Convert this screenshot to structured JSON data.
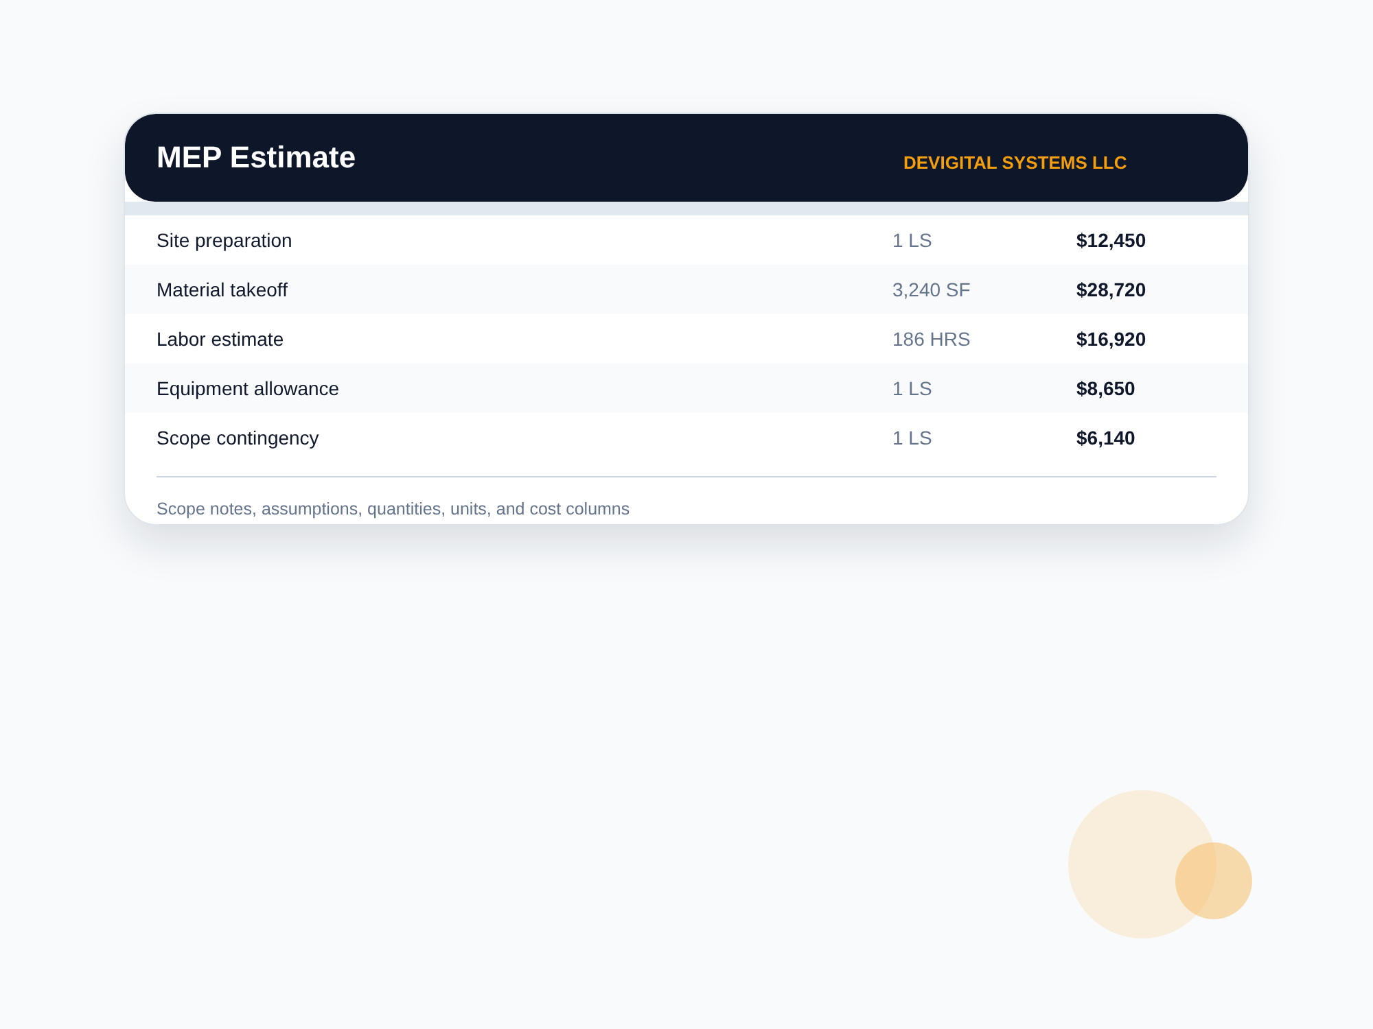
{
  "card": {
    "title": "MEP Estimate",
    "company": "DEVIGITAL SYSTEMS LLC"
  },
  "rows": [
    {
      "item": "Site preparation",
      "quantity": "1 LS",
      "cost": "$12,450"
    },
    {
      "item": "Material takeoff",
      "quantity": "3,240 SF",
      "cost": "$28,720"
    },
    {
      "item": "Labor estimate",
      "quantity": "186 HRS",
      "cost": "$16,920"
    },
    {
      "item": "Equipment allowance",
      "quantity": "1 LS",
      "cost": "$8,650"
    },
    {
      "item": "Scope contingency",
      "quantity": "1 LS",
      "cost": "$6,140"
    }
  ],
  "note": "Scope notes, assumptions, quantities, units, and cost columns"
}
